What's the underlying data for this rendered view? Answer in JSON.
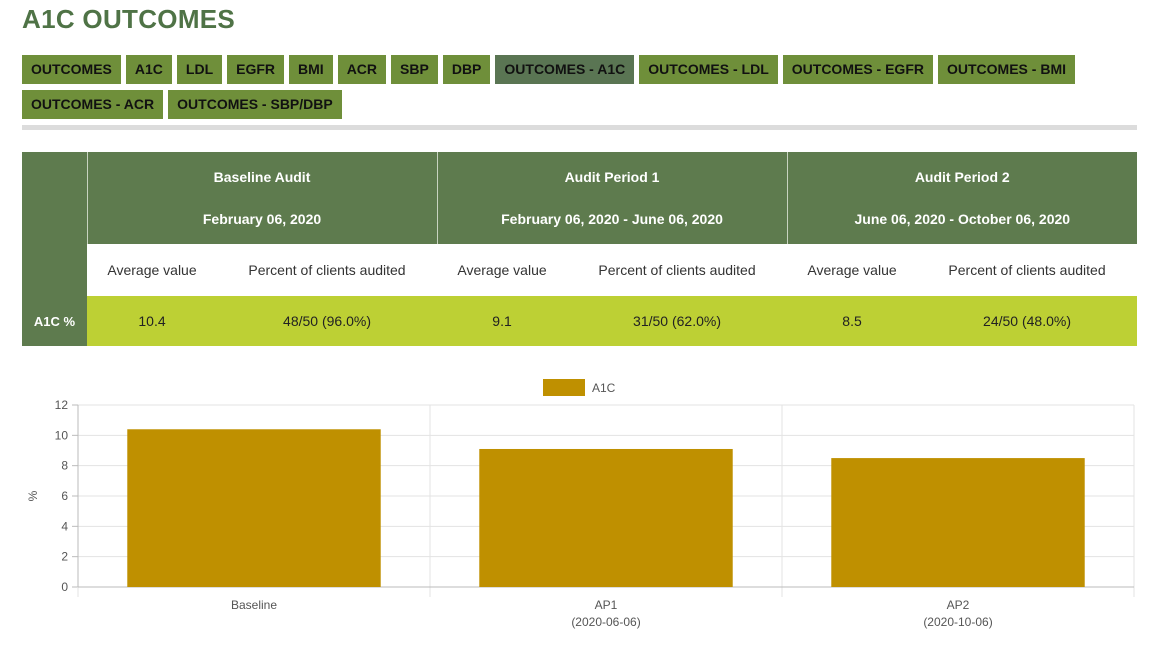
{
  "page": {
    "title": "A1C OUTCOMES"
  },
  "tabs": [
    {
      "label": "OUTCOMES",
      "active": false
    },
    {
      "label": "A1C",
      "active": false
    },
    {
      "label": "LDL",
      "active": false
    },
    {
      "label": "EGFR",
      "active": false
    },
    {
      "label": "BMI",
      "active": false
    },
    {
      "label": "ACR",
      "active": false
    },
    {
      "label": "SBP",
      "active": false
    },
    {
      "label": "DBP",
      "active": false
    },
    {
      "label": "OUTCOMES - A1C",
      "active": true
    },
    {
      "label": "OUTCOMES - LDL",
      "active": false
    },
    {
      "label": "OUTCOMES - EGFR",
      "active": false
    },
    {
      "label": "OUTCOMES - BMI",
      "active": false
    },
    {
      "label": "OUTCOMES - ACR",
      "active": false
    },
    {
      "label": "OUTCOMES - SBP/DBP",
      "active": false
    }
  ],
  "table": {
    "periods": [
      {
        "name": "Baseline Audit",
        "dates": "February 06, 2020"
      },
      {
        "name": "Audit Period 1",
        "dates": "February 06, 2020 - June 06, 2020"
      },
      {
        "name": "Audit Period 2",
        "dates": "June 06, 2020 - October 06, 2020"
      }
    ],
    "subheaders": {
      "average": "Average value",
      "percent": "Percent of clients audited"
    },
    "row": {
      "label": "A1C %",
      "cells": [
        {
          "average": "10.4",
          "percent": "48/50 (96.0%)"
        },
        {
          "average": "9.1",
          "percent": "31/50 (62.0%)"
        },
        {
          "average": "8.5",
          "percent": "24/50 (48.0%)"
        }
      ]
    }
  },
  "colors": {
    "title": "#4f7346",
    "tab": "#6f8f3a",
    "tab_active": "#5a7553",
    "header": "#5e7b4e",
    "row_highlight": "#bdd034",
    "bar": "#bf9000"
  },
  "chart_data": {
    "type": "bar",
    "categories": [
      {
        "label": "Baseline",
        "sublabel": ""
      },
      {
        "label": "AP1",
        "sublabel": "(2020-06-06)"
      },
      {
        "label": "AP2",
        "sublabel": "(2020-10-06)"
      }
    ],
    "series": [
      {
        "name": "A1C",
        "values": [
          10.4,
          9.1,
          8.5
        ],
        "color": "#bf9000"
      }
    ],
    "ylabel": "%",
    "ylim": [
      0,
      12
    ],
    "yticks": [
      0,
      2,
      4,
      6,
      8,
      10,
      12
    ],
    "legend": "top-center",
    "grid": true
  }
}
